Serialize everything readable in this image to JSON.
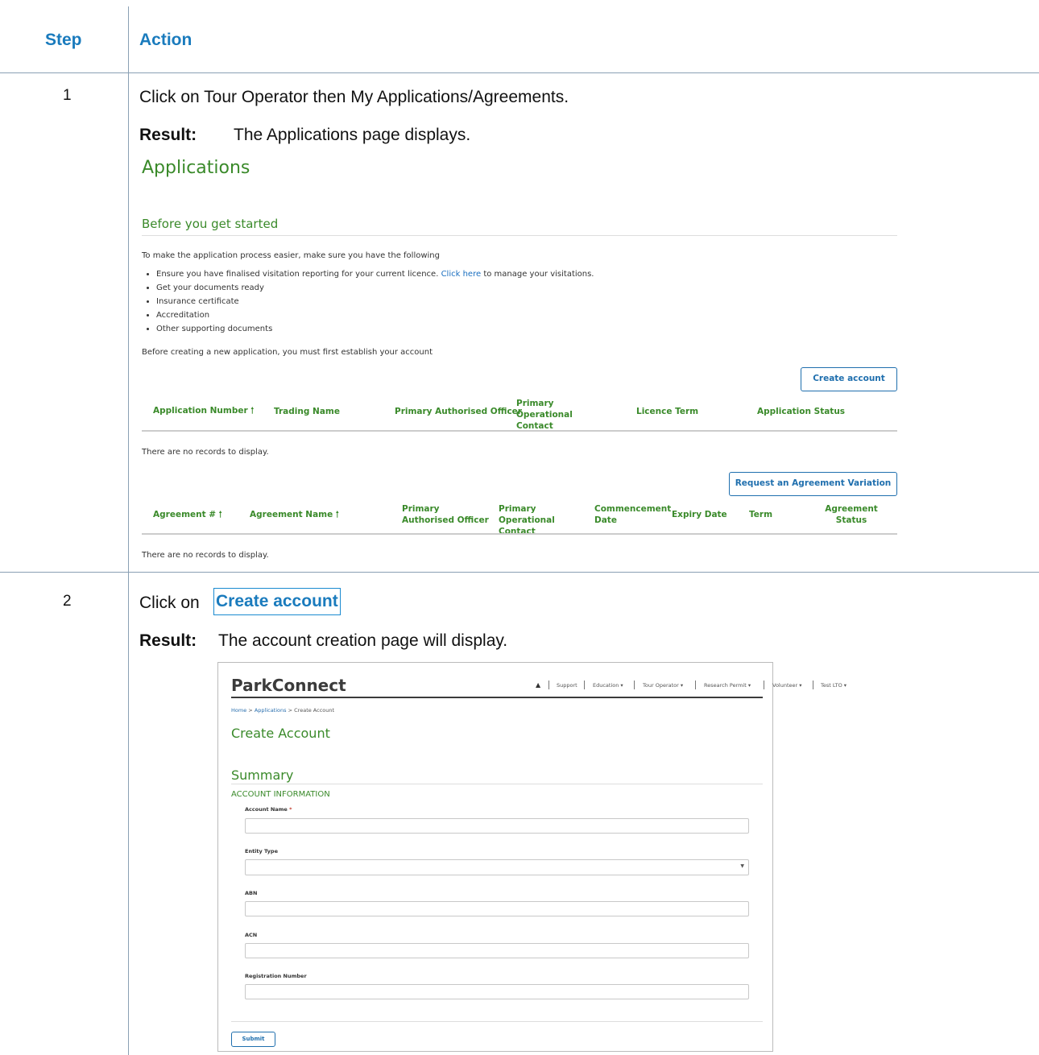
{
  "table": {
    "header_step": "Step",
    "header_action": "Action"
  },
  "step1": {
    "number": "1",
    "instruction": "Click on Tour Operator then My Applications/Agreements.",
    "result_label": "Result:",
    "result_text": "The Applications page displays.",
    "screenshot": {
      "title": "Applications",
      "section_title": "Before you get started",
      "intro": "To make the application process easier, make sure you have the following",
      "bullet1_pre": "Ensure you have finalised visitation reporting for your current licence.",
      "bullet1_link": "Click here",
      "bullet1_post": "to manage your visitations.",
      "bullets": [
        "Get your documents ready",
        "Insurance certificate",
        "Accreditation",
        "Other supporting documents"
      ],
      "before_text": "Before creating a new application, you must first establish your account",
      "create_account_button": "Create account",
      "applications_headers": {
        "app_number": "Application Number",
        "trading_name": "Trading Name",
        "primary_authorised_officer": "Primary Authorised Officer",
        "primary_operational_contact": "Primary Operational Contact",
        "licence_term": "Licence Term",
        "application_status": "Application Status"
      },
      "no_records_1": "There are no records to display.",
      "request_variation_button": "Request an Agreement Variation",
      "agreements_headers": {
        "agreement_no": "Agreement #",
        "agreement_name": "Agreement Name",
        "primary_authorised_officer": "Primary Authorised Officer",
        "primary_operational_contact": "Primary Operational Contact",
        "commencement_date": "Commencement Date",
        "expiry_date": "Expiry Date",
        "term": "Term",
        "agreement_status": "Agreement Status"
      },
      "no_records_2": "There are no records to display."
    }
  },
  "step2": {
    "number": "2",
    "instruction_pre": "Click on",
    "instruction_button": "Create account",
    "result_label": "Result:",
    "result_text": "The account creation page will display.",
    "screenshot": {
      "brand": "ParkConnect",
      "nav": [
        "Support",
        "Education ▾",
        "Tour Operator ▾",
        "Research Permit ▾",
        "Volunteer ▾",
        "Test LTO ▾"
      ],
      "breadcrumb": [
        "Home",
        "Applications",
        "Create Account"
      ],
      "breadcrumb_sep": ">",
      "page_title": "Create Account",
      "summary_title": "Summary",
      "section_title": "ACCOUNT INFORMATION",
      "fields": {
        "account_name": "Account Name",
        "required_mark": "*",
        "entity_type": "Entity Type",
        "abn": "ABN",
        "acn": "ACN",
        "registration_number": "Registration Number"
      },
      "submit_button": "Submit"
    }
  },
  "colors": {
    "header_blue": "#1a7bbd",
    "green": "#3a8a2a",
    "button_blue": "#1f6fae",
    "rule": "#8aa0b4"
  }
}
